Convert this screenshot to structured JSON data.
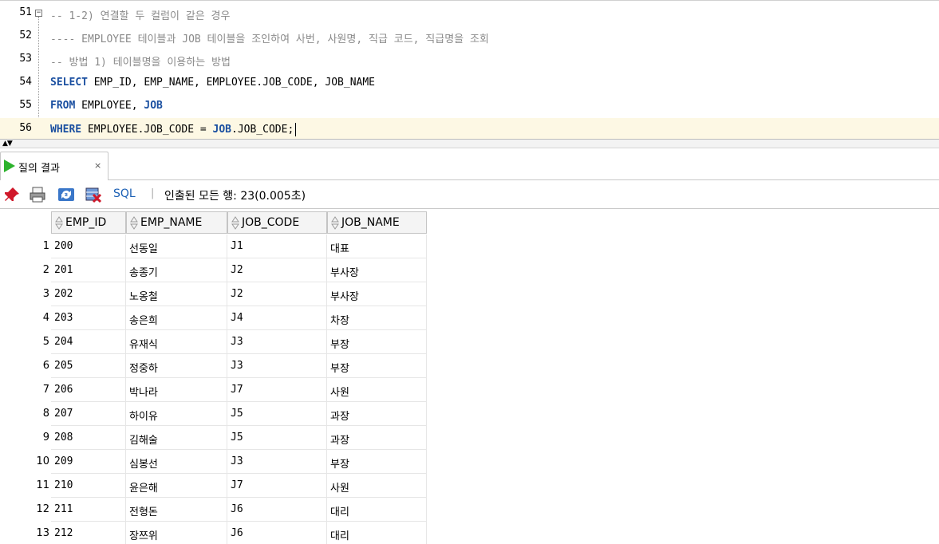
{
  "editor": {
    "lines": [
      {
        "num": "51",
        "fold": "⊟",
        "segments": [
          {
            "t": "-- 1-2) 연결할 두 컬럼이 같은 경우",
            "c": "comment"
          }
        ]
      },
      {
        "num": "52",
        "segments": [
          {
            "t": "---- EMPLOYEE 테이블과 JOB 테이블을 조인하여 사번, 사원명, 직급 코드, 직급명을 조회",
            "c": "comment"
          }
        ]
      },
      {
        "num": "53",
        "segments": [
          {
            "t": "-- 방법 1) 테이블명을 이용하는 방법",
            "c": "comment"
          }
        ]
      },
      {
        "num": "54",
        "segments": [
          {
            "t": "SELECT",
            "c": "kw"
          },
          {
            "t": " EMP_ID, EMP_NAME, EMPLOYEE.JOB_CODE, JOB_NAME",
            "c": "plain"
          }
        ]
      },
      {
        "num": "55",
        "segments": [
          {
            "t": "FROM",
            "c": "kw"
          },
          {
            "t": " EMPLOYEE, ",
            "c": "plain"
          },
          {
            "t": "JOB",
            "c": "kw"
          }
        ]
      },
      {
        "num": "56",
        "current": true,
        "segments": [
          {
            "t": "WHERE",
            "c": "kw"
          },
          {
            "t": " EMPLOYEE.JOB_CODE = ",
            "c": "plain"
          },
          {
            "t": "JOB",
            "c": "kw"
          },
          {
            "t": ".JOB_CODE;",
            "c": "plain"
          }
        ]
      }
    ]
  },
  "result_tab": {
    "label": "질의 결과",
    "close": "×"
  },
  "toolbar": {
    "sql_label": "SQL",
    "separator": "|",
    "status": "인출된 모든 행: 23(0.005초)"
  },
  "grid": {
    "columns": [
      "EMP_ID",
      "EMP_NAME",
      "JOB_CODE",
      "JOB_NAME"
    ],
    "rows": [
      [
        "1",
        "200",
        "선동일",
        "J1",
        "대표"
      ],
      [
        "2",
        "201",
        "송종기",
        "J2",
        "부사장"
      ],
      [
        "3",
        "202",
        "노옹철",
        "J2",
        "부사장"
      ],
      [
        "4",
        "203",
        "송은희",
        "J4",
        "차장"
      ],
      [
        "5",
        "204",
        "유재식",
        "J3",
        "부장"
      ],
      [
        "6",
        "205",
        "정중하",
        "J3",
        "부장"
      ],
      [
        "7",
        "206",
        "박나라",
        "J7",
        "사원"
      ],
      [
        "8",
        "207",
        "하이유",
        "J5",
        "과장"
      ],
      [
        "9",
        "208",
        "김해술",
        "J5",
        "과장"
      ],
      [
        "10",
        "209",
        "심봉선",
        "J3",
        "부장"
      ],
      [
        "11",
        "210",
        "윤은해",
        "J7",
        "사원"
      ],
      [
        "12",
        "211",
        "전형돈",
        "J6",
        "대리"
      ],
      [
        "13",
        "212",
        "장쯔위",
        "J6",
        "대리"
      ]
    ]
  }
}
